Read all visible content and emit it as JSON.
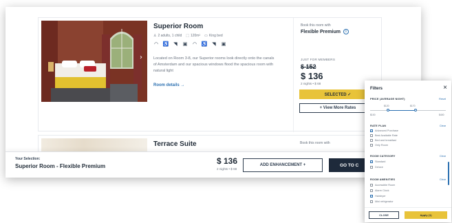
{
  "room1": {
    "title": "Superior Room",
    "specs": [
      "2 adults, 1 child",
      "120m²",
      "King bed"
    ],
    "amenities": [
      "wifi-icon",
      "accessible-icon",
      "hairdryer-icon",
      "minibar-icon",
      "wifi-icon",
      "accessible-icon",
      "hairdryer-icon",
      "minibar-icon"
    ],
    "description": "Located on Room 3-8, our Superior rooms look directly onto the canals of Amsterdam and our spacious windows flood the spacious room with natural light",
    "details_link": "Room details →",
    "rate": {
      "book_label": "Book this room with",
      "plan": "Flexible Premium",
      "members_label": "JUST FOR MEMBERS",
      "old_price": "$ 152",
      "price": "$ 136",
      "nights": "2 nights • $ 68",
      "selected_label": "SELECTED ✓",
      "more_rates_label": "+ View More Rates"
    }
  },
  "room2": {
    "title": "Terrace Suite",
    "book_label": "Book this room with"
  },
  "selection_bar": {
    "label": "Your Selection:",
    "value": "Superior Room - Flexible Premium",
    "price": "$ 136",
    "nights": "2 nights • $ 68",
    "enhancement_label": "ADD ENHANCEMENT +",
    "continue_label": "GO TO C"
  },
  "filters": {
    "title": "Filters",
    "price_section": "PRICE (AVERAGE NIGHT)",
    "reset": "Reset",
    "price_min": "$100",
    "price_max": "$400",
    "range_low": "$120",
    "range_high": "$170",
    "rate_plan_section": "RATE PLAN",
    "rate_plan_reset": "Clear",
    "rate_plans": [
      {
        "label": "Advanced Purchase",
        "checked": true
      },
      {
        "label": "Best Available Rate",
        "checked": false
      },
      {
        "label": "Bed and breakfast",
        "checked": false
      },
      {
        "label": "Only Room",
        "checked": false
      }
    ],
    "category_section": "ROOM CATEGORY",
    "category_reset": "Clear",
    "categories": [
      {
        "label": "Standard",
        "checked": true
      },
      {
        "label": "Deluxe",
        "checked": false
      }
    ],
    "amenities_section": "ROOM AMENITIES",
    "amenities_reset": "Clear",
    "amenities": [
      {
        "label": "Accessible Room",
        "checked": false
      },
      {
        "label": "Alarm Clock",
        "checked": false
      },
      {
        "label": "Hairdryer",
        "checked": true
      },
      {
        "label": "Mini refrigerator",
        "checked": false
      }
    ],
    "clear_label": "CLOSE",
    "apply_label": "Apply (1)"
  }
}
